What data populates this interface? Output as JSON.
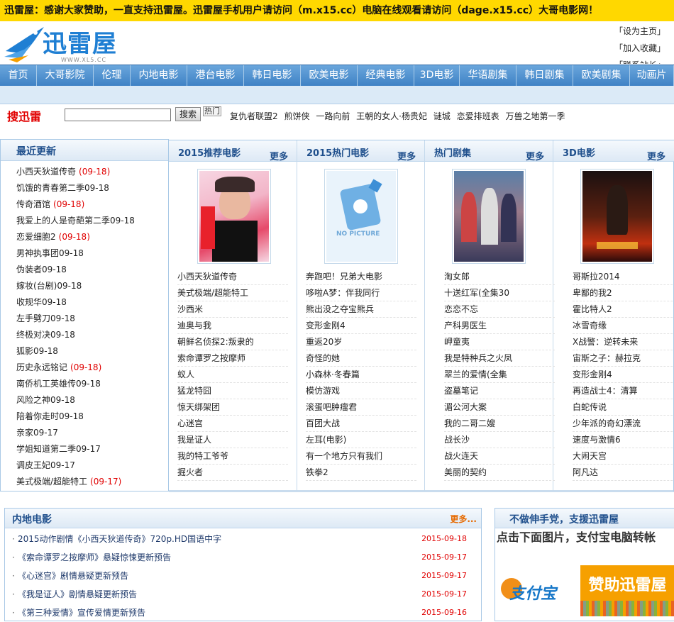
{
  "notice": "迅雷屋：感谢大家赞助，一直支持迅雷屋。迅雷屋手机用户请访问（m.x15.cc）电脑在线观看请访问（dage.x15.cc）大哥电影网！",
  "logo": {
    "brand": "迅雷屋",
    "url": "WWW.XL5.CC"
  },
  "toplinks": [
    "「设为主页」",
    "「加入收藏」",
    "「联系站长」"
  ],
  "nav": [
    "首页",
    "大哥影院",
    "伦理",
    "内地电影",
    "港台电影",
    "韩日电影",
    "欧美电影",
    "经典电影",
    "3D电影",
    "华语剧集",
    "韩日剧集",
    "欧美剧集",
    "动画片"
  ],
  "search": {
    "title": "搜迅雷",
    "button": "搜索",
    "hot_label": "热门",
    "value": ""
  },
  "hot": [
    "复仇者联盟2",
    "煎饼侠",
    "一路向前",
    "王朝的女人·杨贵妃",
    "谜城",
    "恋爱排班表",
    "万兽之地第一季"
  ],
  "recent": {
    "title": "最近更新",
    "items": [
      {
        "name": "小西天狄道传奇",
        "date": "(09-18)",
        "red": true
      },
      {
        "name": "饥饿的青春第二季09-18",
        "date": "",
        "red": false
      },
      {
        "name": "传奇酒馆",
        "date": "(09-18)",
        "red": true
      },
      {
        "name": "我爱上的人是奇葩第二季09-18",
        "date": "",
        "red": false
      },
      {
        "name": "恋爱细胞2",
        "date": "(09-18)",
        "red": true
      },
      {
        "name": "男神执事团09-18",
        "date": "",
        "red": false
      },
      {
        "name": "伪装者09-18",
        "date": "",
        "red": false
      },
      {
        "name": "嫁妆(台剧)09-18",
        "date": "",
        "red": false
      },
      {
        "name": "收规华09-18",
        "date": "",
        "red": false
      },
      {
        "name": "左手劈刀09-18",
        "date": "",
        "red": false
      },
      {
        "name": "终极对决09-18",
        "date": "",
        "red": false
      },
      {
        "name": "狐影09-18",
        "date": "",
        "red": false
      },
      {
        "name": "历史永远铭记",
        "date": "(09-18)",
        "red": true
      },
      {
        "name": "南侨机工英雄传09-18",
        "date": "",
        "red": false
      },
      {
        "name": "风险之神09-18",
        "date": "",
        "red": false
      },
      {
        "name": "陪着你走时09-18",
        "date": "",
        "red": false
      },
      {
        "name": "亲家09-17",
        "date": "",
        "red": false
      },
      {
        "name": "学姐知道第二季09-17",
        "date": "",
        "red": false
      },
      {
        "name": "调皮王妃09-17",
        "date": "",
        "red": false
      },
      {
        "name": "美式极端/超能特工",
        "date": "(09-17)",
        "red": true
      }
    ]
  },
  "columns": [
    {
      "title": "2015推荐电影",
      "more": "更多",
      "items": [
        "小西天狄道传奇",
        "美式极端/超能特工",
        "沙西米",
        "迪奥与我",
        "朝鲜名侦探2:叛隶的",
        "索命谭罗之按摩师",
        "蚁人",
        "猛龙特囧",
        "惊天绑架团",
        "心迷宫",
        "我是证人",
        "我的特工爷爷",
        "掘火者"
      ]
    },
    {
      "title": "2015热门电影",
      "more": "更多",
      "items": [
        "奔跑吧！兄弟大电影",
        "哆啦A梦：伴我同行",
        "熊出没之夺宝熊兵",
        "变形金刚4",
        "重返20岁",
        "奇怪的她",
        "小森林·冬春篇",
        "模仿游戏",
        "滚蛋吧肿瘤君",
        "百团大战",
        "左耳(电影)",
        "有一个地方只有我们",
        "铁拳2"
      ]
    },
    {
      "title": "热门剧集",
      "more": "更多",
      "items": [
        "淘女郎",
        "十送红军(全集30",
        "恋恋不忘",
        "产科男医生",
        "岬童夷",
        "我是特种兵之火凤",
        "翠兰的爱情(全集",
        "盗墓笔记",
        "湄公河大案",
        "我的二哥二嫂",
        "战长沙",
        "战火连天",
        "美丽的契约"
      ]
    },
    {
      "title": "3D电影",
      "more": "更多",
      "items": [
        "哥斯拉2014",
        "卑鄙的我2",
        "霍比特人2",
        "冰雪奇缘",
        "X战警：逆转未来",
        "宙斯之子：赫拉克",
        "变形金刚4",
        "再造战士4：清算",
        "白蛇传说",
        "少年派的奇幻漂流",
        "速度与激情6",
        "大闹天宫",
        "阿凡达"
      ]
    }
  ],
  "mainland": {
    "title": "内地电影",
    "more": "更多...",
    "news": [
      {
        "text": "2015动作剧情《小西天狄道传奇》720p.HD国语中字",
        "date": "2015-09-18"
      },
      {
        "text": "《索命谭罗之按摩师》悬疑惊悚更新预告",
        "date": "2015-09-17"
      },
      {
        "text": "《心迷宫》剧情悬疑更新预告",
        "date": "2015-09-17"
      },
      {
        "text": "《我是证人》剧情悬疑更新预告",
        "date": "2015-09-17"
      },
      {
        "text": "《第三种爱情》宣传爱情更新预告",
        "date": "2015-09-16"
      }
    ]
  },
  "support": {
    "title": "不做伸手党，支援迅雷屋",
    "text": "点击下面图片，支付宝电脑转帐",
    "alipay": "支付宝",
    "button": "赞助迅雷屋"
  },
  "colors": {
    "accent": "#1f7fd3",
    "notice_bg": "#ffd800",
    "nav_bg": "#4d8fcf",
    "date_red": "#e00000",
    "donate": "#f6a000"
  }
}
